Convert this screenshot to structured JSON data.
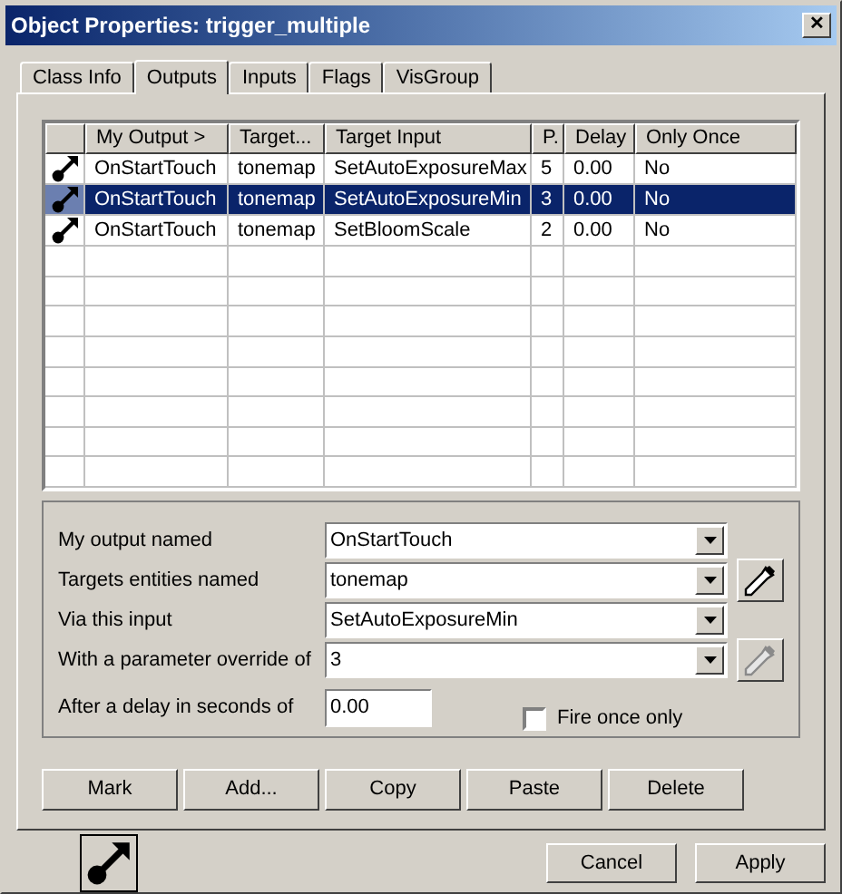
{
  "window": {
    "title": "Object Properties: trigger_multiple",
    "close": "✕"
  },
  "tabs": [
    {
      "label": "Class Info",
      "selected": false
    },
    {
      "label": "Outputs",
      "selected": true
    },
    {
      "label": "Inputs",
      "selected": false
    },
    {
      "label": "Flags",
      "selected": false
    },
    {
      "label": "VisGroup",
      "selected": false
    }
  ],
  "table": {
    "columns": [
      "My Output >",
      "Target...",
      "Target Input",
      "P.",
      "Delay",
      "Only Once"
    ],
    "rows": [
      {
        "cells": [
          "OnStartTouch",
          "tonemap",
          "SetAutoExposureMax",
          "5",
          "0.00",
          "No"
        ],
        "selected": false
      },
      {
        "cells": [
          "OnStartTouch",
          "tonemap",
          "SetAutoExposureMin",
          "3",
          "0.00",
          "No"
        ],
        "selected": true
      },
      {
        "cells": [
          "OnStartTouch",
          "tonemap",
          "SetBloomScale",
          "2",
          "0.00",
          "No"
        ],
        "selected": false
      }
    ]
  },
  "form": {
    "fields": [
      {
        "label": "My output named",
        "value": "OnStartTouch",
        "kind": "combo"
      },
      {
        "label": "Targets entities named",
        "value": "tonemap",
        "kind": "picker",
        "disabled": false
      },
      {
        "label": "Via this input",
        "value": "SetAutoExposureMin",
        "kind": "combo"
      },
      {
        "label": "With a parameter override of",
        "value": "3",
        "kind": "picker",
        "disabled": true
      }
    ],
    "delay": {
      "label": "After a delay in seconds of",
      "value": "0.00"
    },
    "fire_once": {
      "label": "Fire once only",
      "checked": false
    }
  },
  "buttons": [
    "Mark",
    "Add...",
    "Copy",
    "Paste",
    "Delete"
  ],
  "footer": {
    "buttons": [
      "Cancel",
      "Apply"
    ]
  }
}
